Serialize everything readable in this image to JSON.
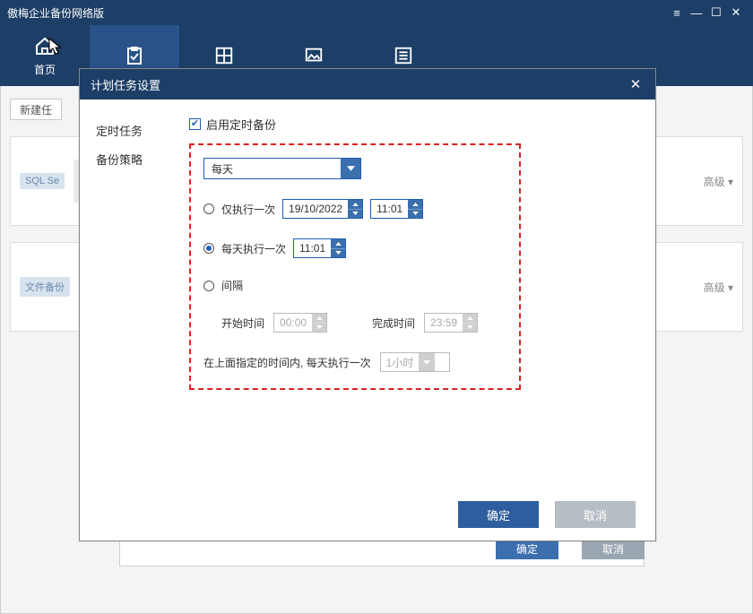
{
  "window": {
    "title": "傲梅企业备份网络版"
  },
  "toolbar": {
    "home": "首页"
  },
  "main": {
    "new_task_btn": "新建任",
    "card1_tag": "SQL Se",
    "card1_adv": "高级 ▾",
    "card2_tag": "文件备份",
    "card2_adv": "高级 ▾",
    "ok": "确定",
    "cancel": "取消"
  },
  "dialog": {
    "title": "计划任务设置",
    "nav": {
      "schedule": "定时任务",
      "policy": "备份策略"
    },
    "enable_label": "启用定时备份",
    "freq_select": "每天",
    "opt_once_label": "仅执行一次",
    "opt_once_date": "19/10/2022",
    "opt_once_time": "11:01",
    "opt_daily_label": "每天执行一次",
    "opt_daily_time": "11:01",
    "opt_interval_label": "间隔",
    "start_label": "开始时间",
    "start_value": "00:00",
    "end_label": "完成时间",
    "end_value": "23:59",
    "repeat_note": "在上面指定的时间内, 每天执行一次",
    "repeat_value": "1小时",
    "ok": "确定",
    "cancel": "取消"
  }
}
